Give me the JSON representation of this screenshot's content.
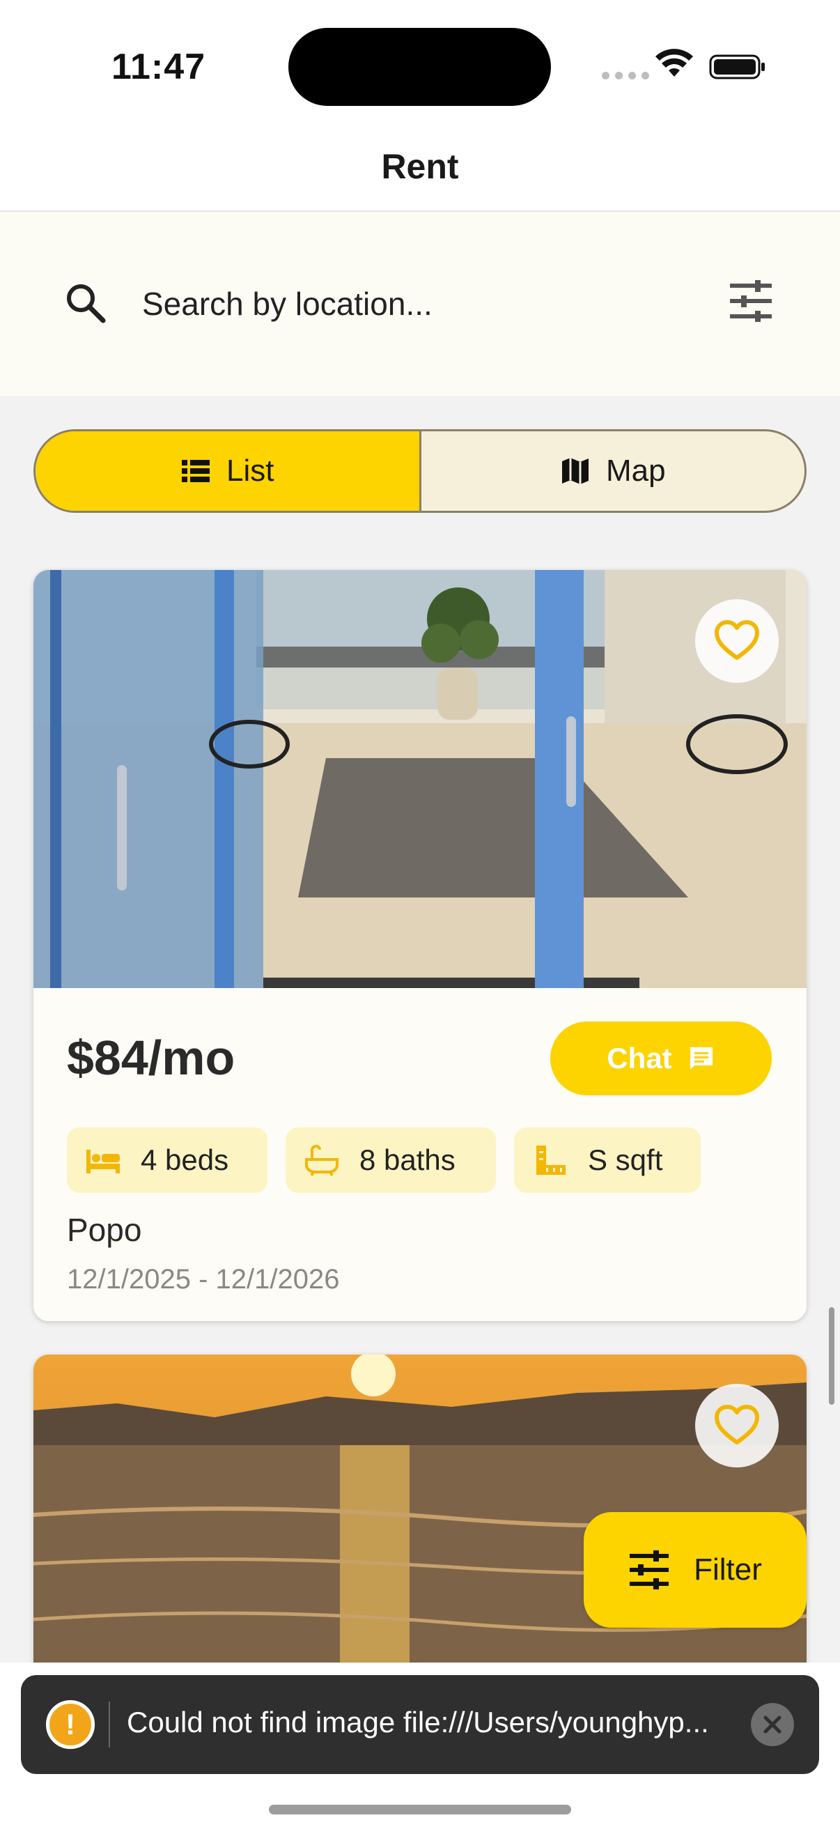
{
  "status_bar": {
    "time": "11:47"
  },
  "nav": {
    "title": "Rent"
  },
  "search": {
    "placeholder": "Search by location..."
  },
  "view_toggle": {
    "list_label": "List",
    "map_label": "Map",
    "selected": "List"
  },
  "listings": [
    {
      "price": "$84/mo",
      "chat_label": "Chat",
      "beds": "4 beds",
      "baths": "8 baths",
      "sqft": "S sqft",
      "name": "Popo",
      "dates": "12/1/2025 - 12/1/2026"
    }
  ],
  "filter_button": {
    "label": "Filter"
  },
  "toast": {
    "message": "Could not find image file:///Users/younghyp..."
  },
  "colors": {
    "accent": "#fdd300",
    "chip_bg": "#fdf4c4",
    "toast_bg": "#2f2f2f",
    "warning": "#f3a51a"
  }
}
